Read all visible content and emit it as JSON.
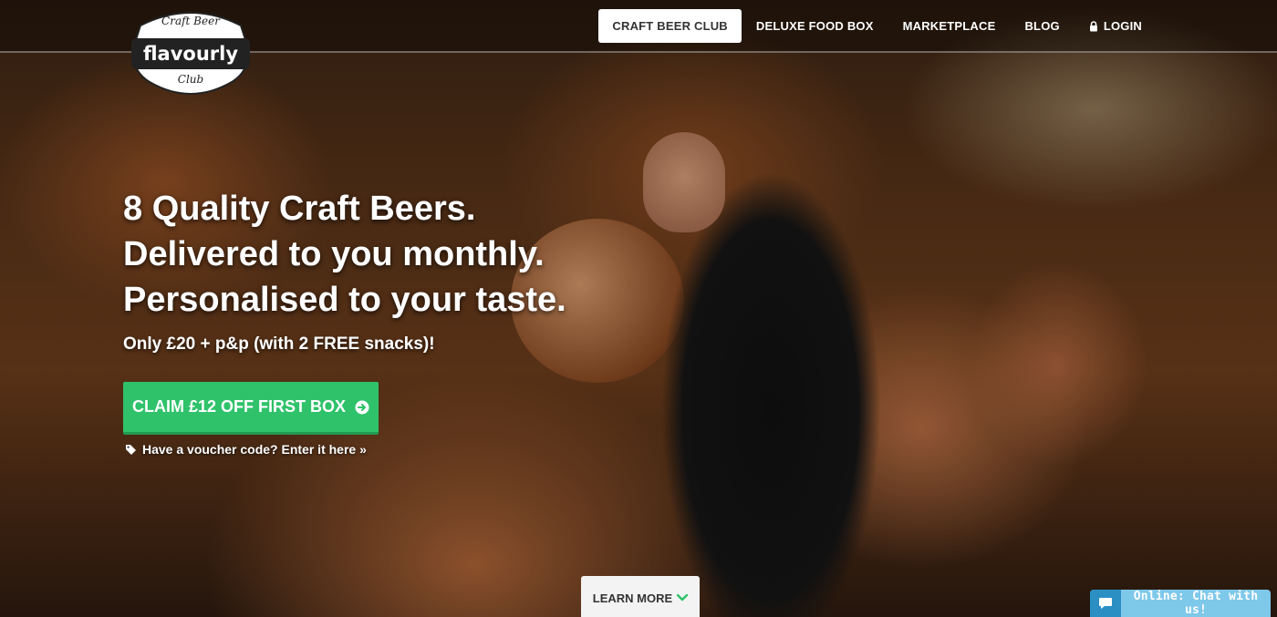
{
  "logo": {
    "top_text": "Craft Beer",
    "name": "flavourly",
    "bottom_text": "Club",
    "alt": "Flavourly Craft Beer Club logo"
  },
  "nav": {
    "items": [
      {
        "label": "CRAFT BEER CLUB",
        "active": true
      },
      {
        "label": "DELUXE FOOD BOX"
      },
      {
        "label": "MARKETPLACE"
      },
      {
        "label": "BLOG"
      },
      {
        "label": "LOGIN",
        "icon": "lock-icon"
      }
    ]
  },
  "hero": {
    "title_lines": [
      "8 Quality Craft Beers.",
      "Delivered to you monthly.",
      "Personalised to your taste."
    ],
    "subtitle": "Only £20 + p&p (with 2 FREE snacks)!",
    "cta_label": "CLAIM £12 OFF FIRST BOX",
    "cta_icon": "arrow-circle-right-icon",
    "voucher_label": "Have a voucher code? Enter it here »",
    "voucher_icon": "tag-icon"
  },
  "learn_more": {
    "label": "LEARN MORE",
    "icon": "chevron-down-icon"
  },
  "chat": {
    "label": "Online: Chat with us!",
    "icon": "speech-bubble-icon"
  },
  "colors": {
    "cta": "#2fc26a",
    "chat": "#7ec8ea",
    "chat_icon_bg": "#2b8fc4",
    "learn_more_chevron": "#2fc26a"
  }
}
